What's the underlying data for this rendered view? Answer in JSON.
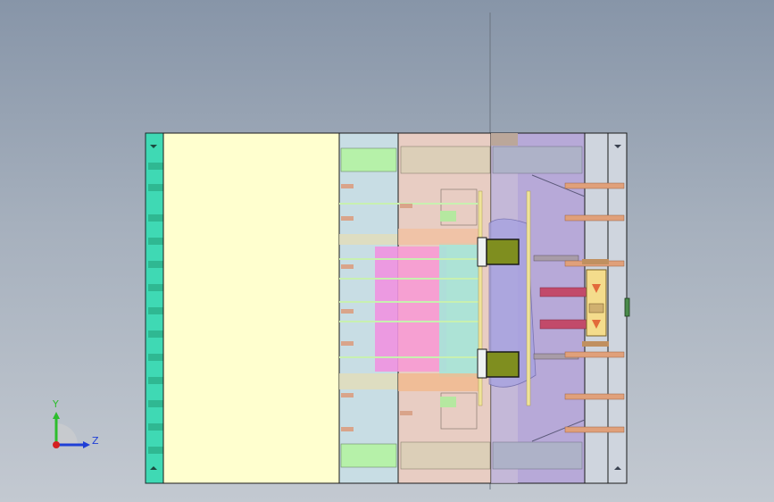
{
  "viewport": {
    "background_top": "#8795a8",
    "background_bottom": "#c3c9d1"
  },
  "model": {
    "name": "",
    "colors": {
      "clamp_plate_left": "#3fd9b4",
      "cavity_plate": "#ffffcf",
      "plate_blue": "#c8dde4",
      "plate_pink": "#e8cdc3",
      "plate_purple": "#b7a9d8",
      "plate_grey": "#cfd5de",
      "guide_pillar_green": "#aee8a6",
      "bushing_tan": "#dccfb8",
      "olive_block": "#7f8e1f",
      "magenta_insert": "#f28ee0",
      "pink_insert": "#f7a3cf",
      "cyan_insert": "#a6e6d8",
      "peach": "#f1b98c",
      "orange_screw": "#e0a07a",
      "ejector_red": "#c24a6a",
      "yellow_rod": "#efe39a",
      "cooling_line": "#c8f0b0"
    }
  },
  "triad": {
    "y_label": "Y",
    "z_label": "Z",
    "y_color": "#2dbd2d",
    "z_color": "#1f3fd6",
    "x_color": "#d42020"
  }
}
